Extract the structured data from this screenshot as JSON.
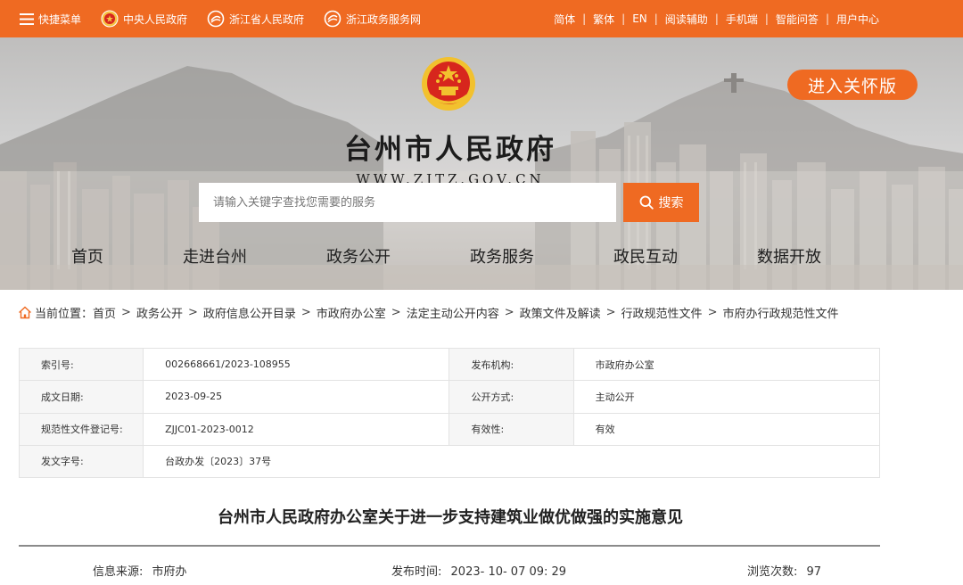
{
  "topbar": {
    "left": [
      {
        "label": "快捷菜单",
        "icon": "menu-icon"
      },
      {
        "label": "中央人民政府",
        "icon": "national-emblem-icon"
      },
      {
        "label": "浙江省人民政府",
        "icon": "zhejiang-logo-icon"
      },
      {
        "label": "浙江政务服务网",
        "icon": "zhejiang-service-logo-icon"
      }
    ],
    "right": [
      "简体",
      "繁体",
      "EN",
      "阅读辅助",
      "手机端",
      "智能问答",
      "用户中心"
    ],
    "separator": "|"
  },
  "banner": {
    "title": "台州市人民政府",
    "url": "WWW.ZJTZ.GOV.CN",
    "care_button": "进入关怀版",
    "search_placeholder": "请输入关键字查找您需要的服务",
    "search_button": "搜索"
  },
  "nav": [
    "首页",
    "走进台州",
    "政务公开",
    "政务服务",
    "政民互动",
    "数据开放"
  ],
  "breadcrumb": {
    "prefix": "当前位置：",
    "items": [
      "首页",
      "政务公开",
      "政府信息公开目录",
      "市政府办公室",
      "法定主动公开内容",
      "政策文件及解读",
      "行政规范性文件",
      "市府办行政规范性文件"
    ],
    "separator": ">"
  },
  "meta": {
    "rows": [
      [
        {
          "k": "索引号:",
          "v": "002668661/2023-108955"
        },
        {
          "k": "发布机构:",
          "v": "市政府办公室"
        }
      ],
      [
        {
          "k": "成文日期:",
          "v": "2023-09-25"
        },
        {
          "k": "公开方式:",
          "v": "主动公开"
        }
      ],
      [
        {
          "k": "规范性文件登记号:",
          "v": "ZJJC01-2023-0012"
        },
        {
          "k": "有效性:",
          "v": "有效"
        }
      ],
      [
        {
          "k": "发文字号:",
          "v": "台政办发〔2023〕37号"
        }
      ]
    ]
  },
  "article": {
    "title": "台州市人民政府办公室关于进一步支持建筑业做优做强的实施意见",
    "source_label": "信息来源:",
    "source_value": "市府办",
    "time_label": "发布时间:",
    "time_value": "2023- 10- 07 09: 29",
    "views_label": "浏览次数:",
    "views_value": "97"
  },
  "colors": {
    "accent": "#ef6a22",
    "emblem_red": "#d7261d",
    "emblem_gold": "#f2c12e"
  }
}
